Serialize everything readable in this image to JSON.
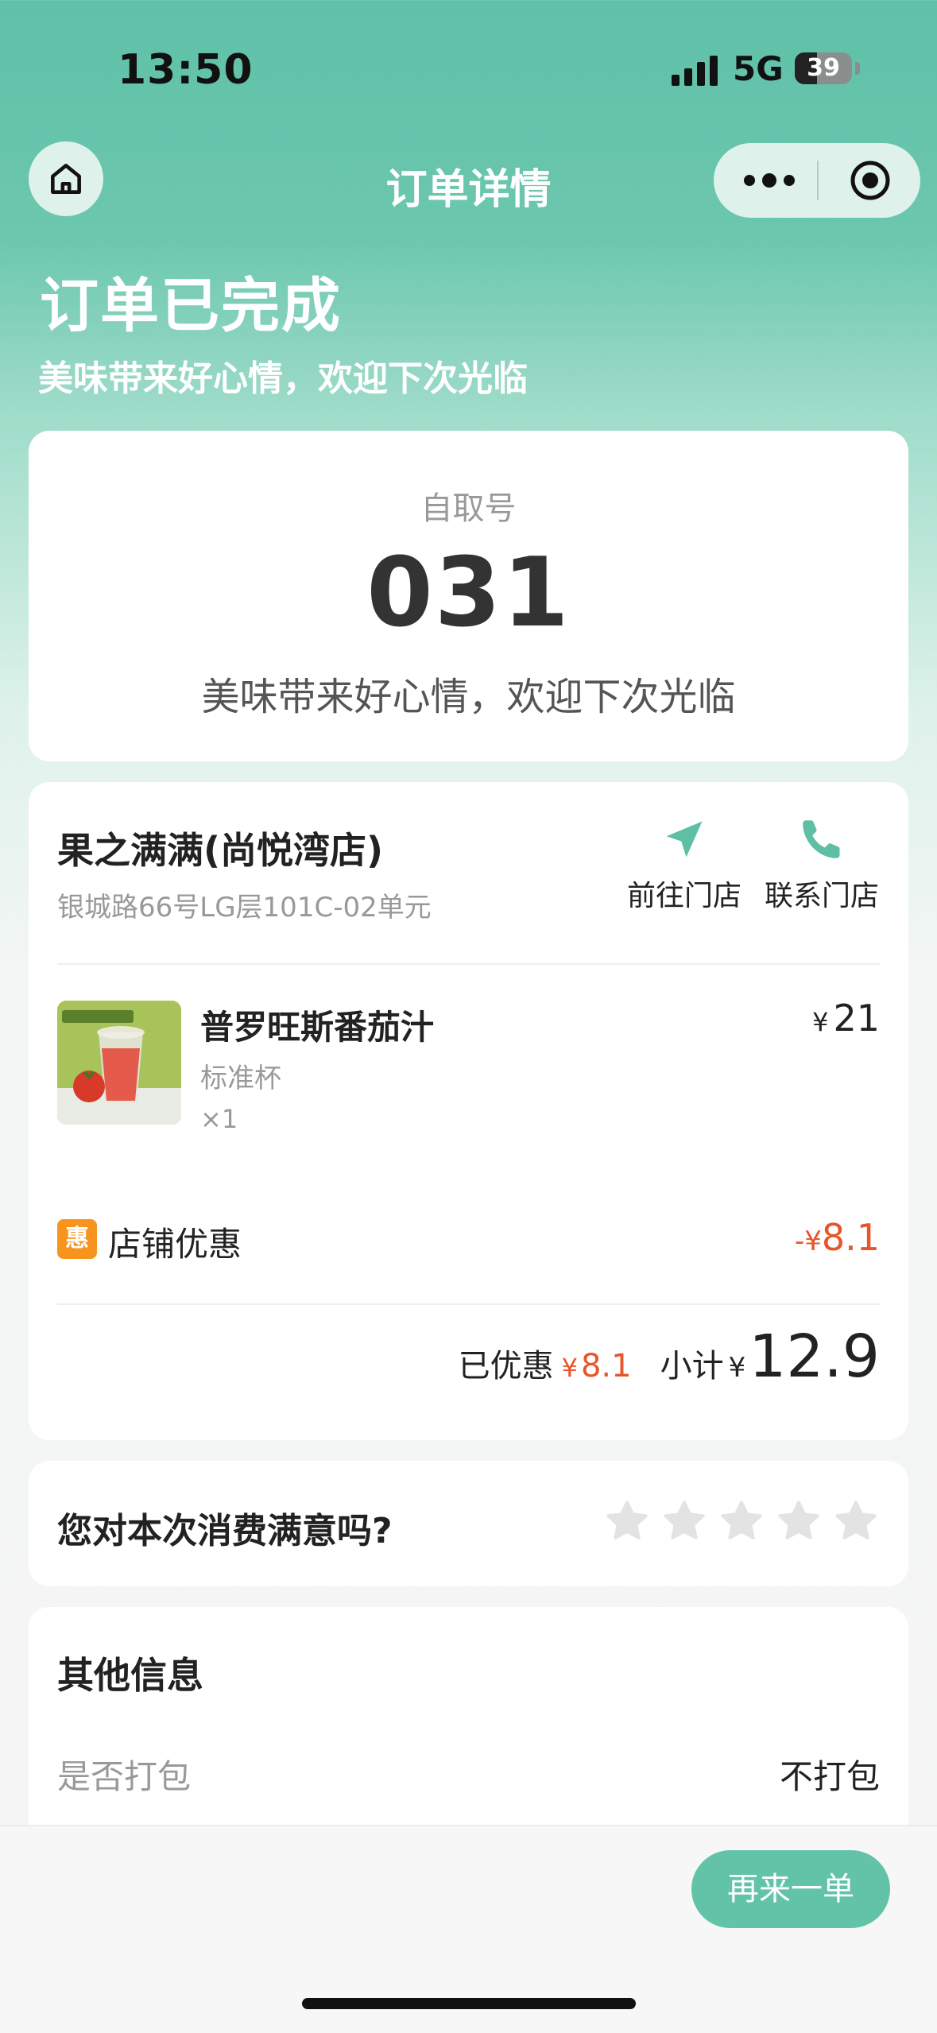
{
  "status_bar": {
    "time": "13:50",
    "network": "5G",
    "battery": "39",
    "battery_level": 0.39
  },
  "nav": {
    "title": "订单详情",
    "home_icon": "home-icon",
    "more_icon": "more-dots-icon",
    "close_icon": "target-icon"
  },
  "order_status": {
    "title": "订单已完成",
    "subtitle": "美味带来好心情，欢迎下次光临"
  },
  "pickup": {
    "label": "自取号",
    "number": "031",
    "message": "美味带来好心情，欢迎下次光临"
  },
  "store": {
    "name": "果之满满(尚悦湾店)",
    "address": "银城路66号LG层101C-02单元",
    "navigate_label": "前往门店",
    "contact_label": "联系门店",
    "accent_color": "#5ebfa5"
  },
  "product": {
    "name": "普罗旺斯番茄汁",
    "spec": "标准杯",
    "qty": "×1",
    "currency": "¥",
    "price": "21"
  },
  "discount": {
    "badge": "惠",
    "label": "店铺优惠",
    "sign": "-",
    "currency": "¥",
    "amount": "8.1"
  },
  "summary": {
    "saved_label": "已优惠",
    "saved_currency": "¥",
    "saved_amount": "8.1",
    "subtotal_label": "小计",
    "currency": "¥",
    "subtotal": "12.9"
  },
  "rating": {
    "question": "您对本次消费满意吗?",
    "stars_total": 5,
    "stars_selected": 0
  },
  "other_info": {
    "title": "其他信息",
    "rows": [
      {
        "key": "是否打包",
        "value": "不打包"
      }
    ]
  },
  "footer": {
    "reorder_label": "再来一单"
  },
  "colors": {
    "primary": "#5ebfa5",
    "discount": "#e8552a",
    "badge": "#f7941d"
  }
}
